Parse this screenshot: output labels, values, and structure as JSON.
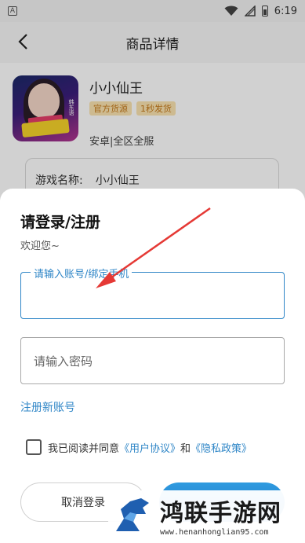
{
  "status_bar": {
    "time": "6:19"
  },
  "header": {
    "title": "商品详情"
  },
  "product": {
    "name": "小小仙王",
    "badges": [
      "官方货源",
      "1秒发货"
    ],
    "platform": "安卓|全区全服",
    "thumb_text": "韩东语"
  },
  "field": {
    "label": "游戏名称:",
    "value": "小小仙王"
  },
  "login": {
    "title": "请登录/注册",
    "subtitle": "欢迎您~",
    "account_label": "请输入账号/绑定手机",
    "account_value": "",
    "password_placeholder": "请输入密码",
    "register_link": "注册新账号",
    "agree_text": "我已阅读并同意",
    "agree_link1": "《用户协议》",
    "agree_and": "和",
    "agree_link2": "《隐私政策》",
    "cancel_label": "取消登录"
  },
  "watermark": {
    "text": "鸿联手游网",
    "url": "www.henanhonglian95.com"
  },
  "colors": {
    "accent": "#2f86c7",
    "badge_bg": "#fbe3b0",
    "badge_text": "#c4791a",
    "arrow": "#e53935"
  }
}
